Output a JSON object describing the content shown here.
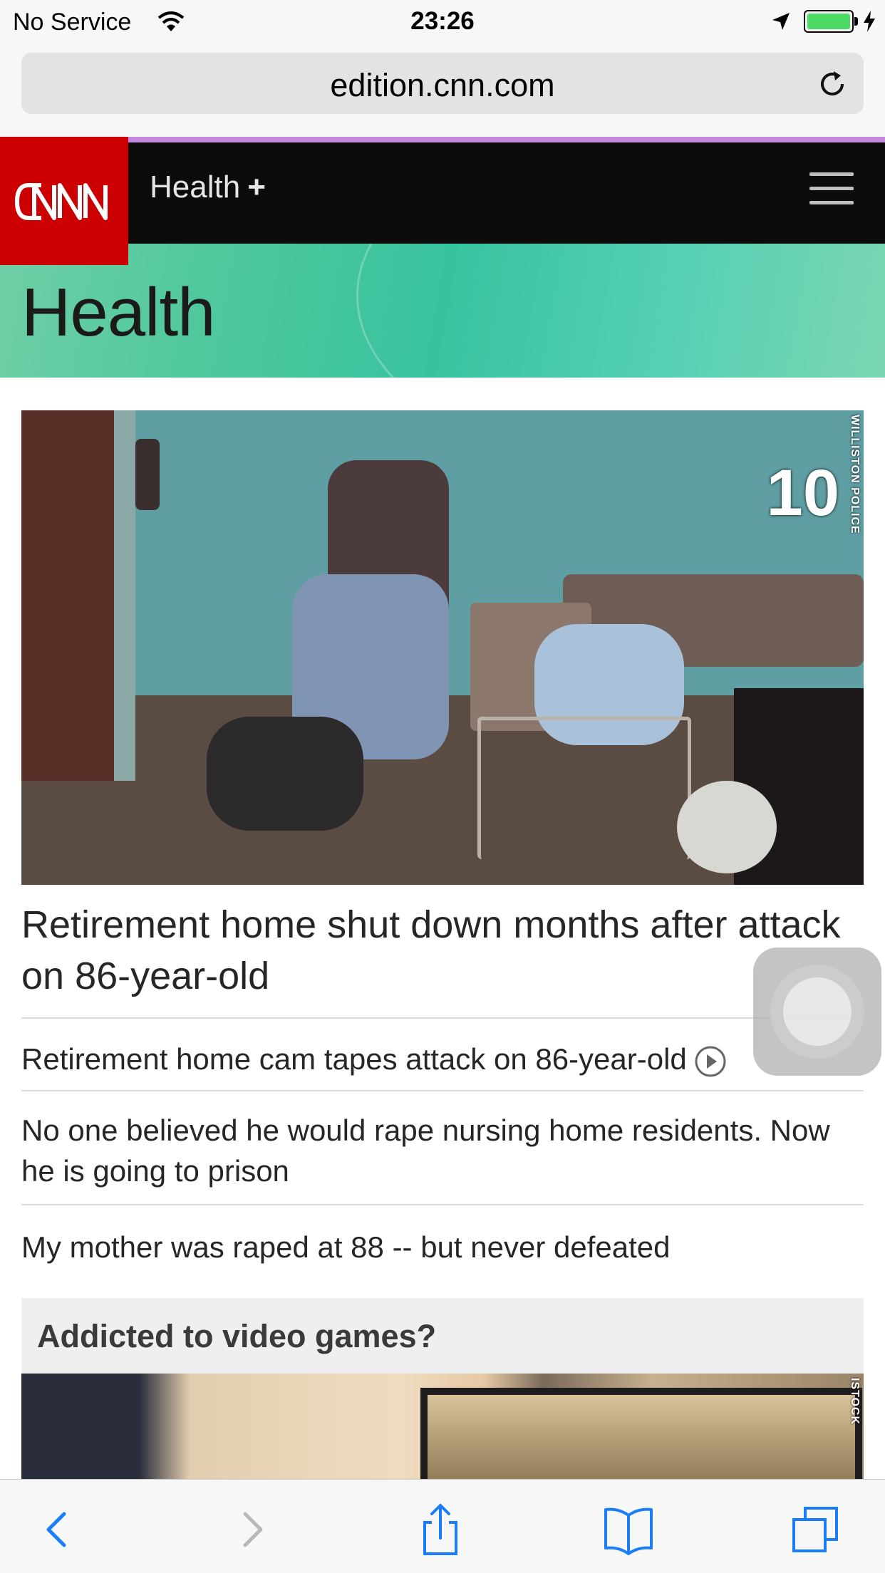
{
  "status_bar": {
    "carrier": "No Service",
    "time": "23:26",
    "battery_level": 1.0
  },
  "browser": {
    "url": "edition.cnn.com"
  },
  "header": {
    "section": "Health",
    "section_plus": "+",
    "logo_text": "CNN",
    "accent_color": "#cc0000"
  },
  "banner": {
    "title": "Health"
  },
  "hero": {
    "overlay_number": "10",
    "credit": "WILLISTON POLICE",
    "headline": "Retirement home shut down months after attack on 86-year-old"
  },
  "related": [
    {
      "text": "Retirement home cam tapes attack on 86-year-old",
      "icon": "play-icon"
    },
    {
      "text": "No one believed he would rape nursing home residents. Now he is going to prison"
    },
    {
      "text": "My mother was raped at 88 -- but never defeated"
    }
  ],
  "promo": {
    "title": "Addicted to video games?",
    "credit": "ISTOCK"
  },
  "toolbar": {
    "icons": [
      "back-icon",
      "forward-icon",
      "share-icon",
      "bookmarks-icon",
      "tabs-icon"
    ]
  }
}
